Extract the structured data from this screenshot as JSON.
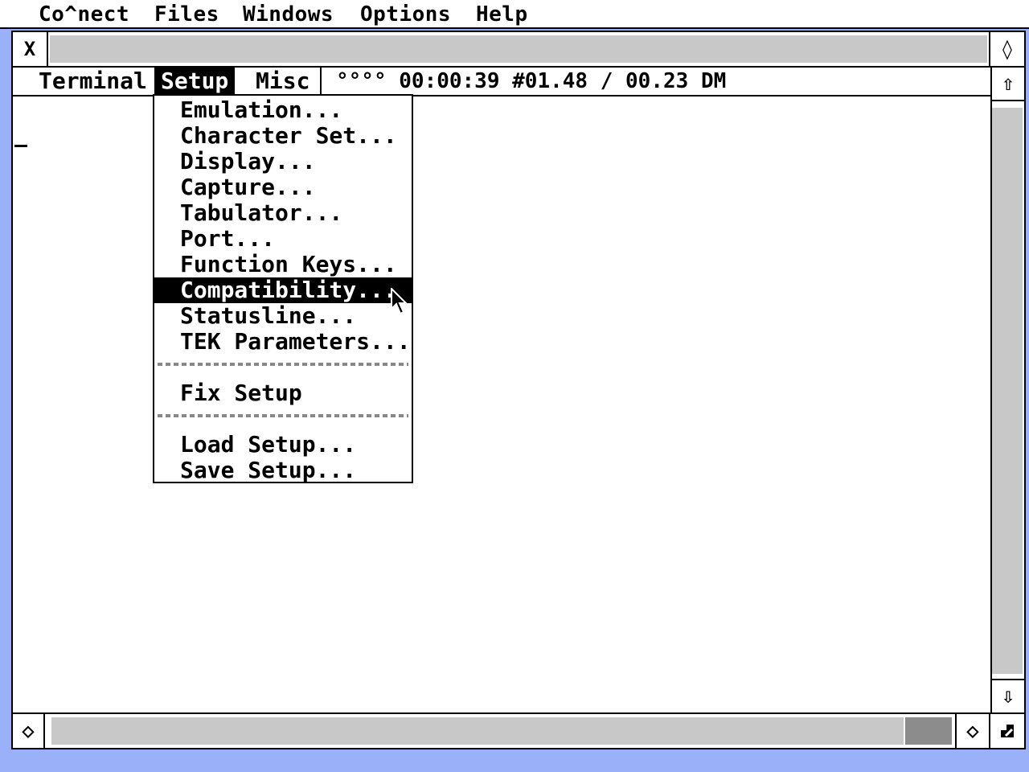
{
  "menubar": {
    "items": [
      "Co^nect",
      "Files",
      "Windows",
      "Options",
      "Help"
    ]
  },
  "window": {
    "close_icon": "X",
    "full_icon": "◊"
  },
  "inner_menu": {
    "items": [
      "Terminal",
      "Setup",
      "Misc"
    ],
    "active": "Setup",
    "status": "°°°° 00:00:39 #01.48 / 00.23 DM"
  },
  "scroll": {
    "up": "⇧",
    "down": "⇩",
    "left": "◇",
    "right": "◇"
  },
  "setup_menu": {
    "items": [
      "Emulation...",
      "Character Set...",
      "Display...",
      "Capture...",
      "Tabulator...",
      "Port...",
      "Function Keys...",
      "Compatibility...",
      "Statusline...",
      "TEK Parameters...",
      "Fix Setup",
      "Load Setup...",
      "Save Setup..."
    ],
    "highlighted": "Compatibility..."
  },
  "colors": {
    "desktop": "#9ab0f8",
    "scroll_track": "#c8c8c8",
    "thumb": "#8c8c8c"
  }
}
